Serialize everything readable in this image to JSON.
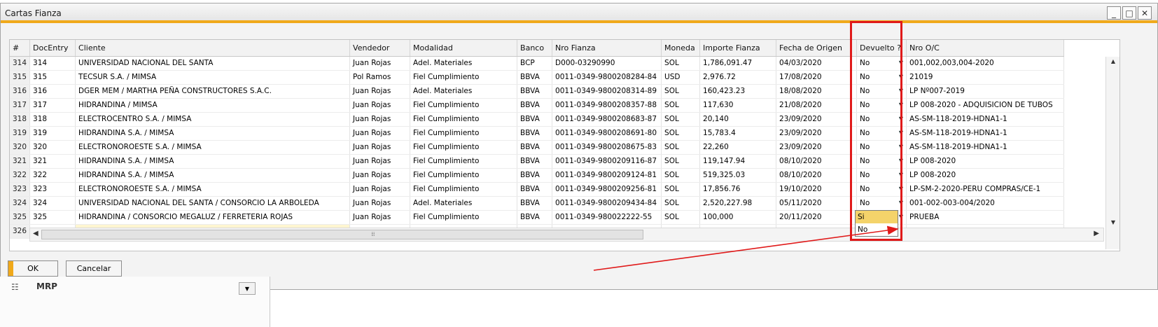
{
  "window": {
    "title": "Cartas Fianza",
    "minimize_icon": "minimize-icon",
    "maximize_icon": "maximize-icon",
    "close_icon": "close-icon"
  },
  "grid": {
    "columns": [
      "#",
      "DocEntry",
      "Cliente",
      "Vendedor",
      "Modalidad",
      "Banco",
      "Nro Fianza",
      "Moneda",
      "Importe Fianza",
      "Fecha de Origen",
      "Devuelto ?",
      "Nro O/C"
    ],
    "rows": [
      {
        "num": "314",
        "doc": "314",
        "cliente": "UNIVERSIDAD NACIONAL DEL SANTA",
        "vendedor": "Juan Rojas",
        "modalidad": "Adel. Materiales",
        "banco": "BCP",
        "fianza": "D000-03290990",
        "moneda": "SOL",
        "importe": "1,786,091.47",
        "fecha": "04/03/2020",
        "devuelto": "No",
        "oc": "001,002,003,004-2020"
      },
      {
        "num": "315",
        "doc": "315",
        "cliente": "TECSUR S.A. / MIMSA",
        "vendedor": "Pol Ramos",
        "modalidad": "Fiel Cumplimiento",
        "banco": "BBVA",
        "fianza": "0011-0349-9800208284-84",
        "moneda": "USD",
        "importe": "2,976.72",
        "fecha": "17/08/2020",
        "devuelto": "No",
        "oc": "21019"
      },
      {
        "num": "316",
        "doc": "316",
        "cliente": "DGER MEM / MARTHA PEÑA CONSTRUCTORES S.A.C.",
        "vendedor": "Juan Rojas",
        "modalidad": "Adel. Materiales",
        "banco": "BBVA",
        "fianza": "0011-0349-9800208314-89",
        "moneda": "SOL",
        "importe": "160,423.23",
        "fecha": "18/08/2020",
        "devuelto": "No",
        "oc": "LP Nº007-2019"
      },
      {
        "num": "317",
        "doc": "317",
        "cliente": "HIDRANDINA / MIMSA",
        "vendedor": "Juan Rojas",
        "modalidad": "Fiel Cumplimiento",
        "banco": "BBVA",
        "fianza": "0011-0349-9800208357-88",
        "moneda": "SOL",
        "importe": "117,630",
        "fecha": "21/08/2020",
        "devuelto": "No",
        "oc": "LP 008-2020 - ADQUISICION DE TUBOS"
      },
      {
        "num": "318",
        "doc": "318",
        "cliente": "ELECTROCENTRO S.A. / MIMSA",
        "vendedor": "Juan Rojas",
        "modalidad": "Fiel Cumplimiento",
        "banco": "BBVA",
        "fianza": "0011-0349-9800208683-87",
        "moneda": "SOL",
        "importe": "20,140",
        "fecha": "23/09/2020",
        "devuelto": "No",
        "oc": "AS-SM-118-2019-HDNA1-1"
      },
      {
        "num": "319",
        "doc": "319",
        "cliente": "HIDRANDINA S.A. / MIMSA",
        "vendedor": "Juan Rojas",
        "modalidad": "Fiel Cumplimiento",
        "banco": "BBVA",
        "fianza": "0011-0349-9800208691-80",
        "moneda": "SOL",
        "importe": "15,783.4",
        "fecha": "23/09/2020",
        "devuelto": "No",
        "oc": "AS-SM-118-2019-HDNA1-1"
      },
      {
        "num": "320",
        "doc": "320",
        "cliente": "ELECTRONOROESTE S.A. / MIMSA",
        "vendedor": "Juan Rojas",
        "modalidad": "Fiel Cumplimiento",
        "banco": "BBVA",
        "fianza": "0011-0349-9800208675-83",
        "moneda": "SOL",
        "importe": "22,260",
        "fecha": "23/09/2020",
        "devuelto": "No",
        "oc": "AS-SM-118-2019-HDNA1-1"
      },
      {
        "num": "321",
        "doc": "321",
        "cliente": "HIDRANDINA S.A. / MIMSA",
        "vendedor": "Juan Rojas",
        "modalidad": "Fiel Cumplimiento",
        "banco": "BBVA",
        "fianza": "0011-0349-9800209116-87",
        "moneda": "SOL",
        "importe": "119,147.94",
        "fecha": "08/10/2020",
        "devuelto": "No",
        "oc": "LP 008-2020"
      },
      {
        "num": "322",
        "doc": "322",
        "cliente": "HIDRANDINA S.A. / MIMSA",
        "vendedor": "Juan Rojas",
        "modalidad": "Fiel Cumplimiento",
        "banco": "BBVA",
        "fianza": "0011-0349-9800209124-81",
        "moneda": "SOL",
        "importe": "519,325.03",
        "fecha": "08/10/2020",
        "devuelto": "No",
        "oc": "LP 008-2020"
      },
      {
        "num": "323",
        "doc": "323",
        "cliente": "ELECTRONOROESTE S.A. / MIMSA",
        "vendedor": "Juan Rojas",
        "modalidad": "Fiel Cumplimiento",
        "banco": "BBVA",
        "fianza": "0011-0349-9800209256-81",
        "moneda": "SOL",
        "importe": "17,856.76",
        "fecha": "19/10/2020",
        "devuelto": "No",
        "oc": "LP-SM-2-2020-PERU COMPRAS/CE-1"
      },
      {
        "num": "324",
        "doc": "324",
        "cliente": "UNIVERSIDAD NACIONAL DEL SANTA / CONSORCIO LA ARBOLEDA",
        "vendedor": "Juan Rojas",
        "modalidad": "Adel. Materiales",
        "banco": "BBVA",
        "fianza": "0011-0349-9800209434-84",
        "moneda": "SOL",
        "importe": "2,520,227.98",
        "fecha": "05/11/2020",
        "devuelto": "No",
        "oc": "001-002-003-004/2020"
      },
      {
        "num": "325",
        "doc": "325",
        "cliente": "HIDRANDINA / CONSORCIO MEGALUZ / FERRETERIA ROJAS",
        "vendedor": "Juan Rojas",
        "modalidad": "Fiel Cumplimiento",
        "banco": "BBVA",
        "fianza": "0011-0349-980022222-55",
        "moneda": "SOL",
        "importe": "100,000",
        "fecha": "20/11/2020",
        "devuelto": "Si",
        "oc": "PRUEBA"
      },
      {
        "num": "326",
        "doc": "",
        "cliente": "",
        "vendedor": "",
        "modalidad": "",
        "banco": "",
        "fianza": "",
        "moneda": "",
        "importe": "",
        "fecha": "",
        "devuelto": "",
        "oc": ""
      }
    ]
  },
  "dropdown": {
    "options": [
      "Si",
      "No"
    ],
    "selected": "Si"
  },
  "buttons": {
    "ok": "OK",
    "cancel": "Cancelar"
  },
  "sidepanel": {
    "label": "MRP",
    "icon": "mrp-icon"
  },
  "colors": {
    "accent": "#f0a91b",
    "highlight": "#e01a1a",
    "selected": "#f4d36a"
  }
}
